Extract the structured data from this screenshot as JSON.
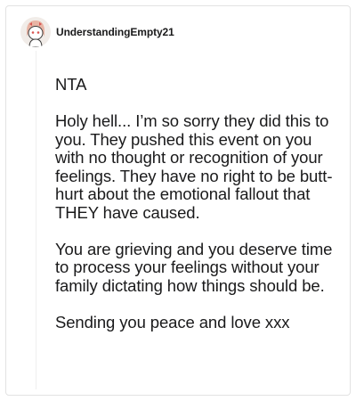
{
  "comment": {
    "author": "UnderstandingEmpty21",
    "avatar_icon": "snoo-avatar-icon",
    "paragraphs": [
      "NTA",
      "Holy hell... I’m so sorry they did this to you. They pushed this event on you with no thought or recognition of your feelings. They have no right to be butt-hurt about the emotional fallout that THEY have caused.",
      "You are grieving and you deserve time to process your feelings without your family dictating how things should be.",
      "Sending you peace and love xxx"
    ]
  },
  "colors": {
    "text": "#1a1a1b",
    "border": "#e2e2e2",
    "avatar_hair": "#e8b4a4",
    "avatar_accent": "#d9534f"
  }
}
